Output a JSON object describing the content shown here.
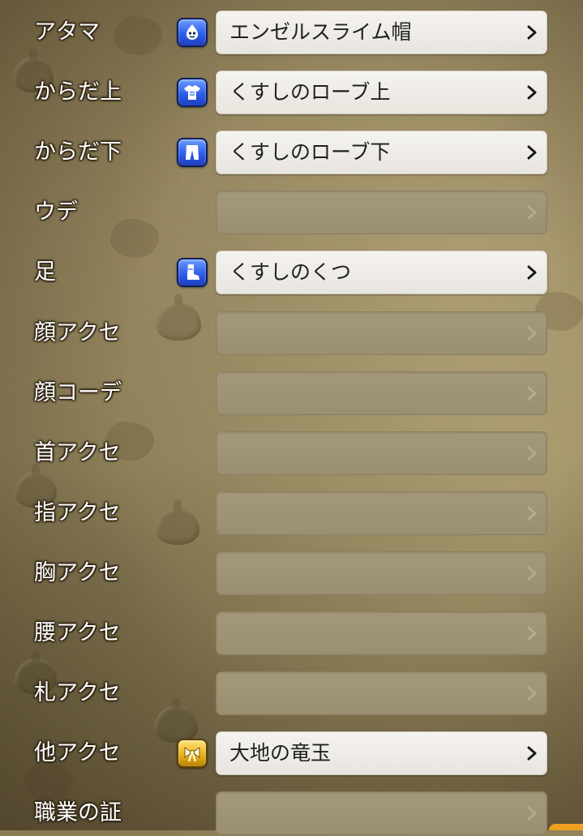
{
  "equipment": {
    "slots": [
      {
        "label": "アタマ",
        "item": "エンゼルスライム帽",
        "icon": "slime-head-icon",
        "icon_color": "blue"
      },
      {
        "label": "からだ上",
        "item": "くすしのローブ上",
        "icon": "shirt-icon",
        "icon_color": "blue"
      },
      {
        "label": "からだ下",
        "item": "くすしのローブ下",
        "icon": "pants-icon",
        "icon_color": "blue"
      },
      {
        "label": "ウデ",
        "item": "",
        "icon": "",
        "icon_color": ""
      },
      {
        "label": "足",
        "item": "くすしのくつ",
        "icon": "boot-icon",
        "icon_color": "blue"
      },
      {
        "label": "顔アクセ",
        "item": "",
        "icon": "",
        "icon_color": ""
      },
      {
        "label": "顔コーデ",
        "item": "",
        "icon": "",
        "icon_color": ""
      },
      {
        "label": "首アクセ",
        "item": "",
        "icon": "",
        "icon_color": ""
      },
      {
        "label": "指アクセ",
        "item": "",
        "icon": "",
        "icon_color": ""
      },
      {
        "label": "胸アクセ",
        "item": "",
        "icon": "",
        "icon_color": ""
      },
      {
        "label": "腰アクセ",
        "item": "",
        "icon": "",
        "icon_color": ""
      },
      {
        "label": "札アクセ",
        "item": "",
        "icon": "",
        "icon_color": ""
      },
      {
        "label": "他アクセ",
        "item": "大地の竜玉",
        "icon": "ribbon-icon",
        "icon_color": "gold"
      },
      {
        "label": "職業の証",
        "item": "",
        "icon": "",
        "icon_color": ""
      }
    ]
  },
  "colors": {
    "background": "#9a8b63",
    "filled_button": "#eeebe6",
    "empty_button": "#9f9476",
    "icon_blue": "#2e5ee8",
    "icon_gold": "#e9b21c",
    "accent_orange": "#f0a020"
  }
}
